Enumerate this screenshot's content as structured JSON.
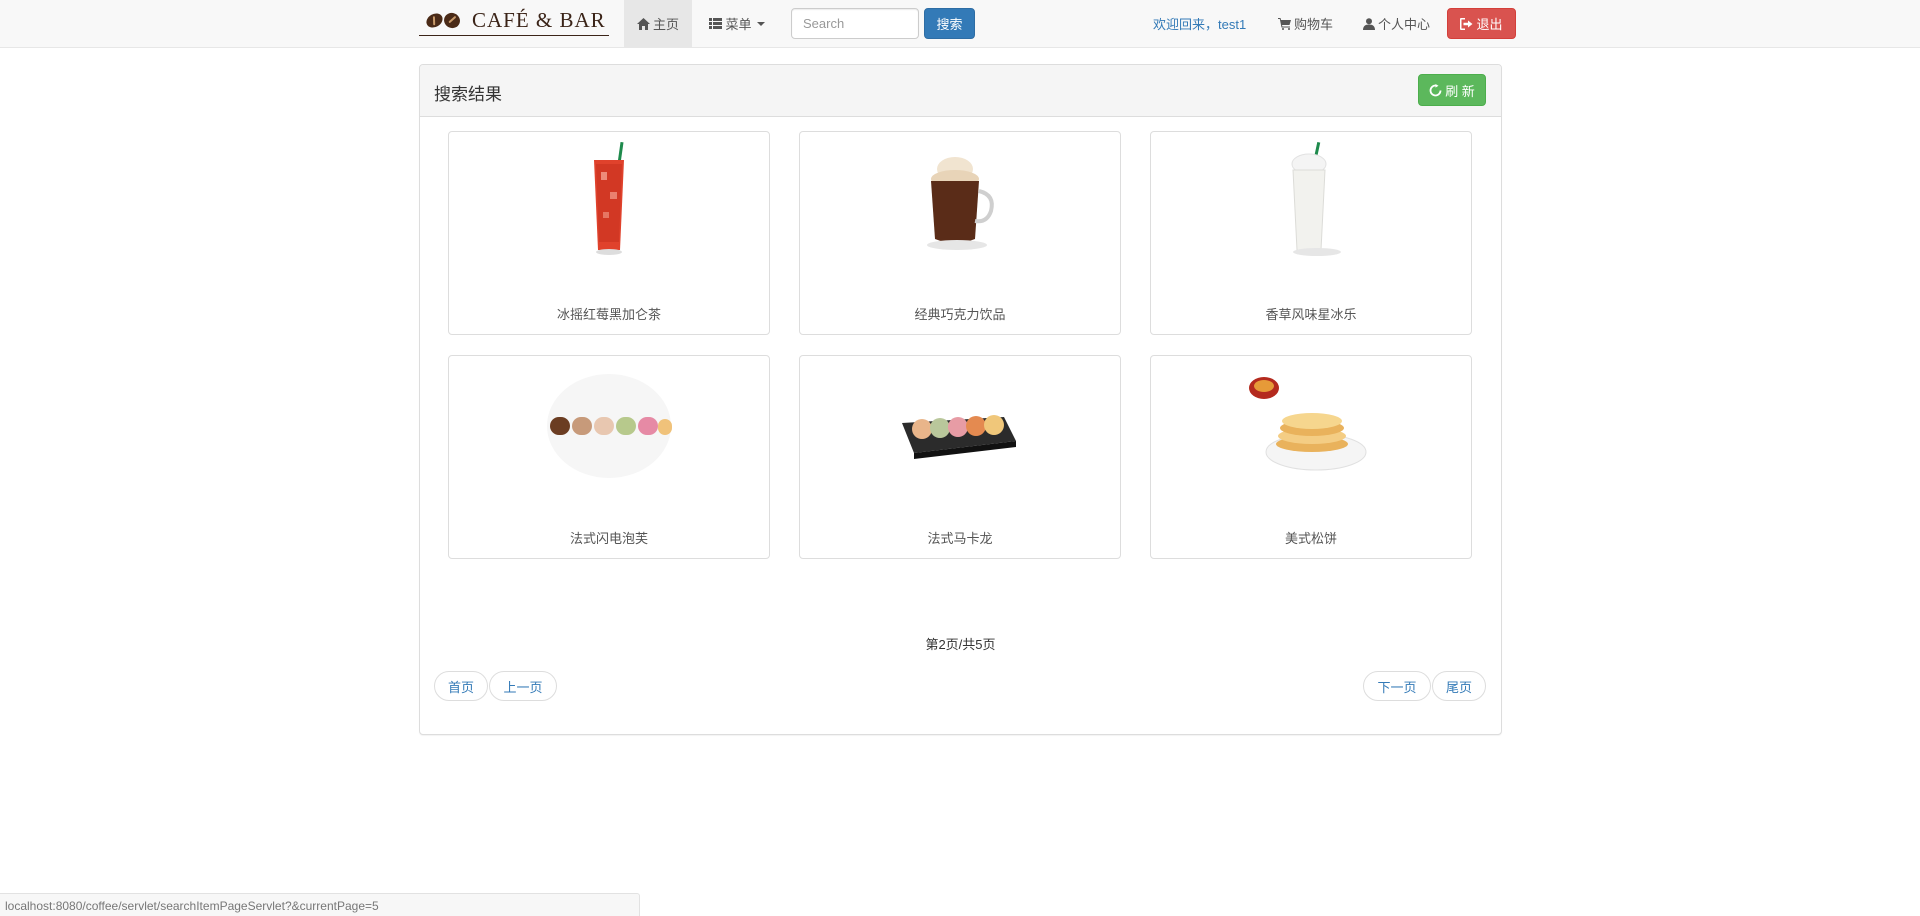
{
  "brand": {
    "name": "CAFÉ & BAR"
  },
  "navbar": {
    "home_label": "主页",
    "menu_label": "菜单",
    "search_placeholder": "Search",
    "search_button": "搜索",
    "welcome_text": "欢迎回来，test1",
    "cart_label": "购物车",
    "profile_label": "个人中心",
    "logout_label": "退出"
  },
  "panel": {
    "title": "搜索结果",
    "refresh_label": "刷 新"
  },
  "products": [
    {
      "name": "冰摇红莓黑加仑茶",
      "icon": "iced-tea-icon"
    },
    {
      "name": "经典巧克力饮品",
      "icon": "hot-chocolate-icon"
    },
    {
      "name": "香草风味星冰乐",
      "icon": "vanilla-frappuccino-icon"
    },
    {
      "name": "法式闪电泡芙",
      "icon": "eclair-icon"
    },
    {
      "name": "法式马卡龙",
      "icon": "macaron-icon"
    },
    {
      "name": "美式松饼",
      "icon": "pancake-icon"
    }
  ],
  "pagination": {
    "info": "第2页/共5页",
    "first": "首页",
    "prev": "上一页",
    "next": "下一页",
    "last": "尾页"
  },
  "statusbar": {
    "url": "localhost:8080/coffee/servlet/searchItemPageServlet?&currentPage=5"
  },
  "colors": {
    "primary": "#337ab7",
    "success": "#5cb85c",
    "danger": "#d9534f",
    "brand": "#3b2418"
  }
}
